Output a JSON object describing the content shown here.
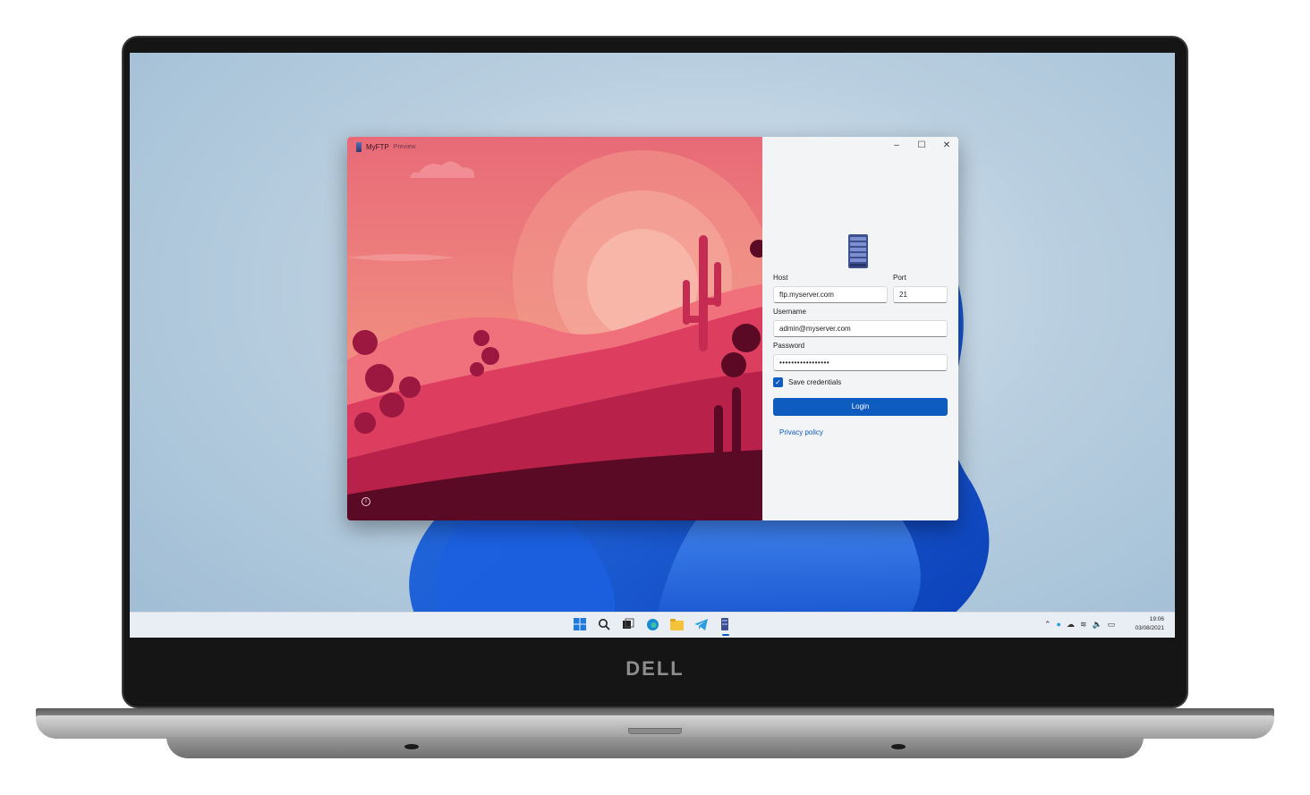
{
  "device": {
    "brand": "DELL"
  },
  "window": {
    "title": "MyFTP",
    "title_suffix": "Preview",
    "controls": {
      "minimize": "–",
      "maximize": "☐",
      "close": "✕"
    }
  },
  "form": {
    "host_label": "Host",
    "host_value": "ftp.myserver.com",
    "port_label": "Port",
    "port_value": "21",
    "username_label": "Username",
    "username_value": "admin@myserver.com",
    "password_label": "Password",
    "password_value": "•••••••••••••••••",
    "save_credentials_label": "Save credentials",
    "save_credentials_checked": true,
    "login_label": "Login",
    "privacy_label": "Privacy policy"
  },
  "taskbar": {
    "apps": [
      "windows-start-icon",
      "search-icon",
      "task-view-icon",
      "edge-icon",
      "file-explorer-icon",
      "telegram-icon",
      "myftp-icon"
    ],
    "clock_time": "19:06",
    "clock_date": "03/08/2021"
  },
  "colors": {
    "accent": "#0f5cc0"
  }
}
